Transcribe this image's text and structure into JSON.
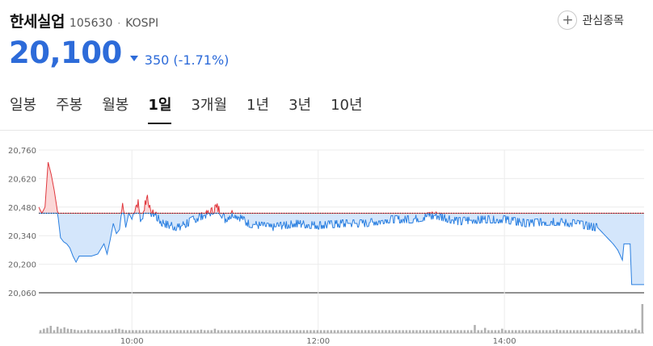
{
  "stock": {
    "name": "한세실업",
    "code": "105630",
    "separator": "·",
    "market": "KOSPI",
    "price": "20,100",
    "change_amount": "350",
    "change_percent": "(-1.71%)",
    "direction": "down",
    "accent_color": "#2d6bd9",
    "up_color": "#e0383e"
  },
  "favorite": {
    "icon": "plus-icon",
    "label": "관심종목"
  },
  "tabs": [
    {
      "label": "일봉",
      "active": false
    },
    {
      "label": "주봉",
      "active": false
    },
    {
      "label": "월봉",
      "active": false
    },
    {
      "label": "1일",
      "active": true
    },
    {
      "label": "3개월",
      "active": false
    },
    {
      "label": "1년",
      "active": false
    },
    {
      "label": "3년",
      "active": false
    },
    {
      "label": "10년",
      "active": false
    }
  ],
  "chart_data": {
    "type": "area",
    "title": "",
    "xlabel": "",
    "ylabel": "",
    "ylim": [
      20060,
      20760
    ],
    "y_ticks": [
      "20,760",
      "20,620",
      "20,480",
      "20,340",
      "20,200",
      "20,060"
    ],
    "y_tick_values": [
      20760,
      20620,
      20480,
      20340,
      20200,
      20060
    ],
    "x_range": [
      "09:00",
      "15:30"
    ],
    "x_ticks": [
      "10:00",
      "12:00",
      "14:00"
    ],
    "reference_price": 20450,
    "grid": true,
    "series": [
      {
        "values_by_time": [
          [
            "09:00",
            20480
          ],
          [
            "09:02",
            20450
          ],
          [
            "09:04",
            20480
          ],
          [
            "09:06",
            20700
          ],
          [
            "09:08",
            20640
          ],
          [
            "09:10",
            20560
          ],
          [
            "09:12",
            20460
          ],
          [
            "09:14",
            20330
          ],
          [
            "09:16",
            20310
          ],
          [
            "09:18",
            20300
          ],
          [
            "09:20",
            20280
          ],
          [
            "09:22",
            20240
          ],
          [
            "09:24",
            20210
          ],
          [
            "09:26",
            20240
          ],
          [
            "09:30",
            20240
          ],
          [
            "09:34",
            20240
          ],
          [
            "09:38",
            20250
          ],
          [
            "09:42",
            20300
          ],
          [
            "09:44",
            20250
          ],
          [
            "09:46",
            20320
          ],
          [
            "09:48",
            20400
          ],
          [
            "09:50",
            20350
          ],
          [
            "09:52",
            20370
          ],
          [
            "09:54",
            20500
          ],
          [
            "09:56",
            20380
          ],
          [
            "09:58",
            20450
          ],
          [
            "10:00",
            20420
          ],
          [
            "10:02",
            20480
          ],
          [
            "10:04",
            20500
          ],
          [
            "10:06",
            20400
          ],
          [
            "10:08",
            20480
          ],
          [
            "10:10",
            20540
          ],
          [
            "10:12",
            20450
          ],
          [
            "10:14",
            20450
          ],
          [
            "10:20",
            20400
          ],
          [
            "10:30",
            20380
          ],
          [
            "10:40",
            20420
          ],
          [
            "10:50",
            20450
          ],
          [
            "10:55",
            20480
          ],
          [
            "11:00",
            20420
          ],
          [
            "11:05",
            20450
          ],
          [
            "11:15",
            20400
          ],
          [
            "11:30",
            20380
          ],
          [
            "11:45",
            20400
          ],
          [
            "12:00",
            20390
          ],
          [
            "12:15",
            20400
          ],
          [
            "12:30",
            20400
          ],
          [
            "12:45",
            20420
          ],
          [
            "13:00",
            20420
          ],
          [
            "13:15",
            20440
          ],
          [
            "13:30",
            20410
          ],
          [
            "13:45",
            20420
          ],
          [
            "14:00",
            20420
          ],
          [
            "14:15",
            20400
          ],
          [
            "14:30",
            20410
          ],
          [
            "14:45",
            20400
          ],
          [
            "15:00",
            20380
          ],
          [
            "15:05",
            20340
          ],
          [
            "15:10",
            20300
          ],
          [
            "15:13",
            20270
          ],
          [
            "15:16",
            20220
          ],
          [
            "15:17",
            20300
          ],
          [
            "15:20",
            20300
          ],
          [
            "15:21",
            20300
          ],
          [
            "15:22",
            20100
          ],
          [
            "15:30",
            20100
          ]
        ]
      }
    ],
    "volume": {
      "relative_heights": [
        0.1,
        0.15,
        0.18,
        0.25,
        0.1,
        0.22,
        0.15,
        0.2,
        0.15,
        0.14,
        0.12,
        0.1,
        0.1,
        0.1,
        0.12,
        0.1,
        0.1,
        0.1,
        0.1,
        0.1,
        0.1,
        0.12,
        0.15,
        0.15,
        0.12,
        0.1,
        0.1,
        0.1,
        0.1,
        0.1,
        0.1,
        0.1,
        0.1,
        0.1,
        0.1,
        0.1,
        0.1,
        0.1,
        0.1,
        0.1,
        0.1,
        0.1,
        0.1,
        0.1,
        0.1,
        0.1,
        0.1,
        0.12,
        0.1,
        0.1,
        0.1,
        0.15,
        0.1,
        0.1,
        0.1,
        0.1,
        0.1,
        0.1,
        0.1,
        0.1,
        0.1,
        0.1,
        0.1,
        0.1,
        0.1,
        0.1,
        0.1,
        0.1,
        0.1,
        0.1,
        0.1,
        0.1,
        0.1,
        0.1,
        0.1,
        0.1,
        0.1,
        0.1,
        0.1,
        0.1,
        0.1,
        0.1,
        0.1,
        0.1,
        0.1,
        0.1,
        0.1,
        0.1,
        0.1,
        0.1,
        0.1,
        0.1,
        0.1,
        0.1,
        0.1,
        0.1,
        0.1,
        0.1,
        0.1,
        0.1,
        0.1,
        0.1,
        0.1,
        0.1,
        0.1,
        0.1,
        0.1,
        0.1,
        0.1,
        0.1,
        0.1,
        0.1,
        0.1,
        0.1,
        0.1,
        0.1,
        0.1,
        0.1,
        0.1,
        0.1,
        0.1,
        0.1,
        0.1,
        0.1,
        0.1,
        0.1,
        0.1,
        0.28,
        0.1,
        0.1,
        0.18,
        0.1,
        0.1,
        0.1,
        0.1,
        0.15,
        0.1,
        0.1,
        0.1,
        0.1,
        0.1,
        0.1,
        0.1,
        0.1,
        0.1,
        0.1,
        0.1,
        0.1,
        0.1,
        0.1,
        0.1,
        0.12,
        0.1,
        0.1,
        0.1,
        0.1,
        0.1,
        0.1,
        0.1,
        0.1,
        0.1,
        0.1,
        0.1,
        0.1,
        0.1,
        0.1,
        0.1,
        0.1,
        0.1,
        0.12,
        0.1,
        0.12,
        0.1,
        0.1,
        0.15,
        0.1,
        1.0
      ]
    }
  }
}
